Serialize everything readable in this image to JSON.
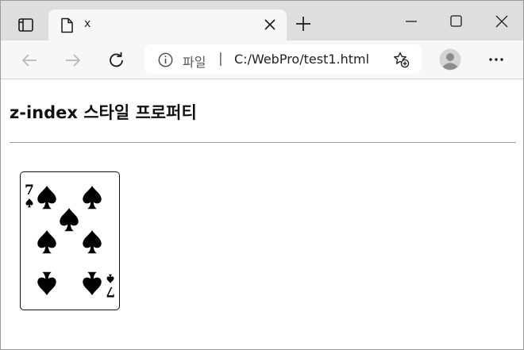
{
  "browser": {
    "tab": {
      "title": "x"
    },
    "address_bar": {
      "site_label": "파일",
      "separator": "|",
      "url": "C:/WebPro/test1.html"
    }
  },
  "page": {
    "heading": "z-index 스타일 프로퍼티",
    "card": {
      "rank": "7",
      "suit": "spade"
    }
  }
}
